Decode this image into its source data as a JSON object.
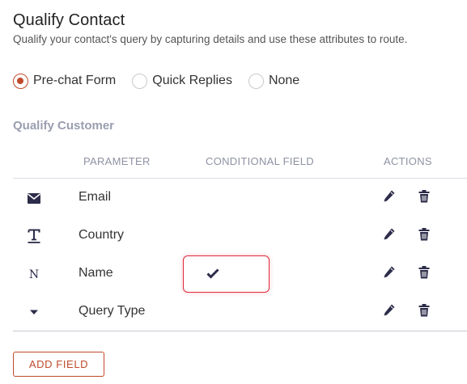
{
  "header": {
    "title": "Qualify Contact",
    "description": "Qualify your contact's query by capturing details and use these attributes to route."
  },
  "qualify_mode": {
    "selected": "Pre-chat Form",
    "options": [
      {
        "label": "Pre-chat Form",
        "checked": true
      },
      {
        "label": "Quick Replies",
        "checked": false
      },
      {
        "label": "None",
        "checked": false
      }
    ]
  },
  "section": {
    "title": "Qualify Customer"
  },
  "table": {
    "columns": {
      "parameter": "PARAMETER",
      "conditional": "CONDITIONAL FIELD",
      "actions": "ACTIONS"
    },
    "rows": [
      {
        "icon": "envelope-icon",
        "label": "Email",
        "conditional": false
      },
      {
        "icon": "text-type-icon",
        "label": "Country",
        "conditional": false
      },
      {
        "icon": "n-letter-icon",
        "label": "Name",
        "conditional": true
      },
      {
        "icon": "caret-down-icon",
        "label": "Query Type",
        "conditional": false
      }
    ]
  },
  "buttons": {
    "add_field": "ADD FIELD"
  },
  "colors": {
    "accent": "#bf4a2a",
    "highlight_border": "#e0283a",
    "icon": "#2c2c4a",
    "muted_heading": "#9a9eb0"
  }
}
